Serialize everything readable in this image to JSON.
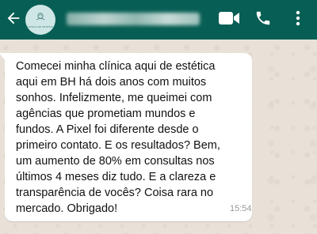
{
  "header": {
    "background_color": "#075e54",
    "back_icon": "arrow-left-icon",
    "avatar": {
      "logo_text": "CLÍNICA DE ESTÉTICA",
      "background_color": "#cfe6e6"
    },
    "icons": [
      "video-camera-icon",
      "phone-icon",
      "more-vertical-icon"
    ]
  },
  "chat": {
    "background_color": "#e9e1d8",
    "message": {
      "text": "Comecei minha clínica aqui de estética\naqui em BH há dois anos com muitos\nsonhos. Infelizmente, me queimei com\nagências que prometiam mundos e\nfundos. A Pixel foi diferente desde o\nprimeiro contato. E os resultados? Bem,\num aumento de 80% em consultas nos\núltimos 4 meses diz tudo. E a clareza e\ntransparência de vocês? Coisa rara no\nmercado. Obrigado!",
      "time": "15:54",
      "bubble_color": "#ffffff"
    }
  }
}
